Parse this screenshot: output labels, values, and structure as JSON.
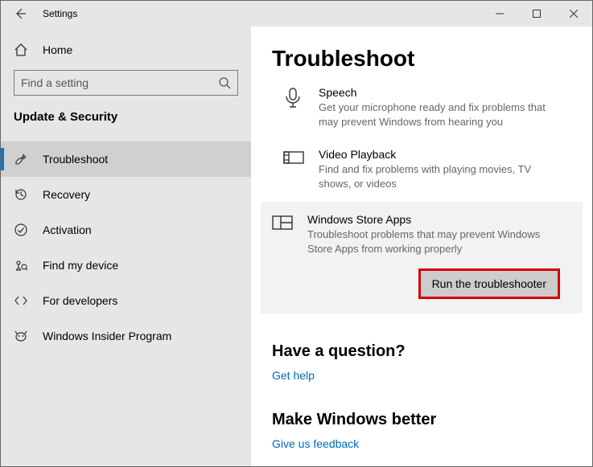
{
  "window": {
    "title": "Settings"
  },
  "sidebar": {
    "home_label": "Home",
    "search_placeholder": "Find a setting",
    "section_title": "Update & Security",
    "items": [
      {
        "label": "Troubleshoot"
      },
      {
        "label": "Recovery"
      },
      {
        "label": "Activation"
      },
      {
        "label": "Find my device"
      },
      {
        "label": "For developers"
      },
      {
        "label": "Windows Insider Program"
      }
    ]
  },
  "content": {
    "heading": "Troubleshoot",
    "items": [
      {
        "title": "Speech",
        "desc": "Get your microphone ready and fix problems that may prevent Windows from hearing you"
      },
      {
        "title": "Video Playback",
        "desc": "Find and fix problems with playing movies, TV shows, or videos"
      },
      {
        "title": "Windows Store Apps",
        "desc": "Troubleshoot problems that may prevent Windows Store Apps from working properly"
      }
    ],
    "run_label": "Run the troubleshooter",
    "question_heading": "Have a question?",
    "get_help_link": "Get help",
    "better_heading": "Make Windows better",
    "feedback_link": "Give us feedback"
  }
}
